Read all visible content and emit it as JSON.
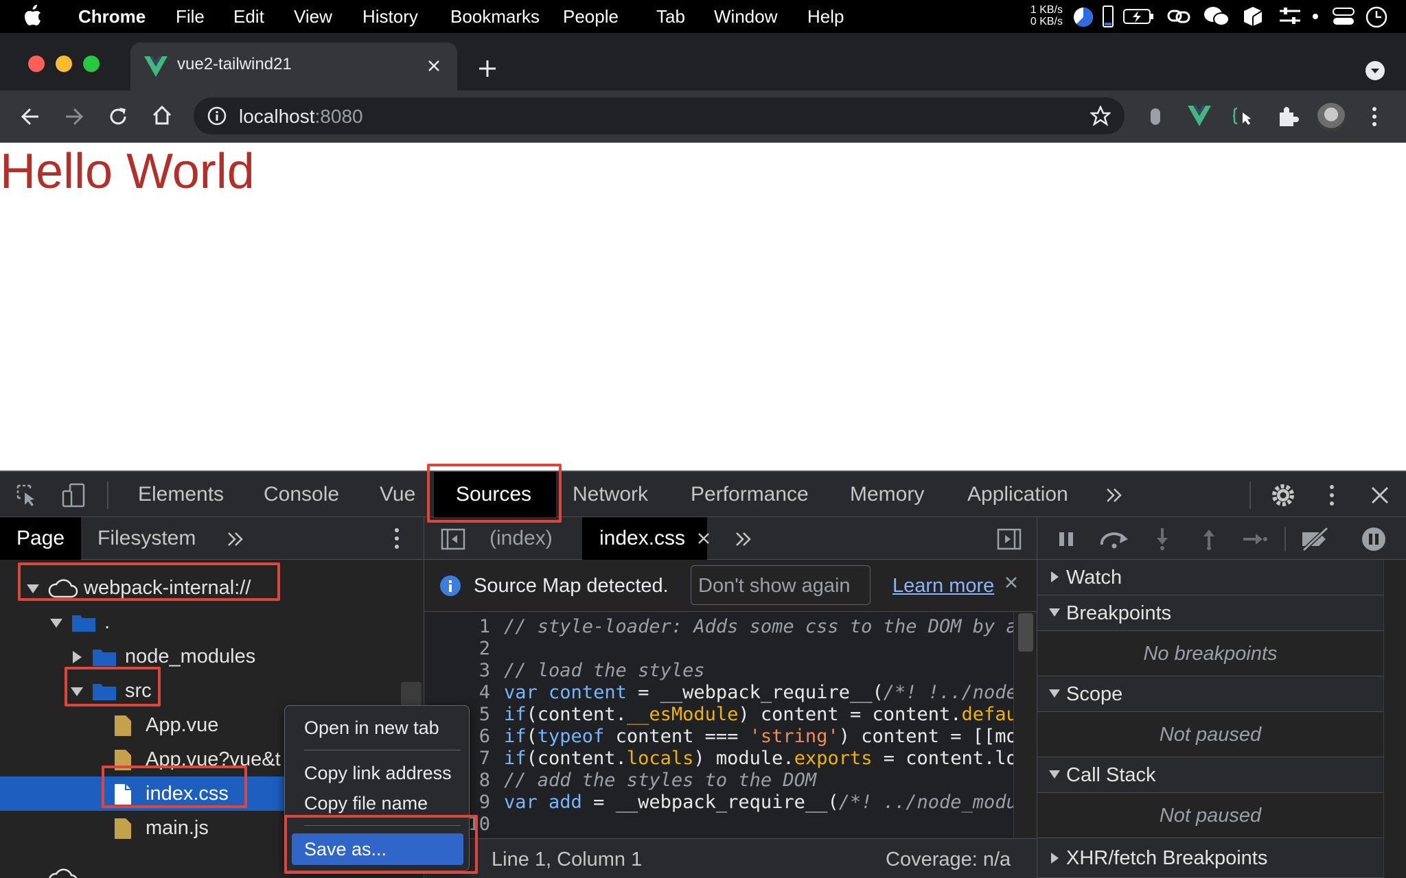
{
  "menubar": {
    "app": "Chrome",
    "items": [
      "File",
      "Edit",
      "View",
      "History",
      "Bookmarks",
      "People",
      "Tab",
      "Window",
      "Help"
    ],
    "net_up": "1 KB/s",
    "net_down": "0 KB/s"
  },
  "browser": {
    "tab_title": "vue2-tailwind21",
    "url_host": "localhost",
    "url_port": ":8080"
  },
  "page": {
    "heading": "Hello World"
  },
  "devtools": {
    "tabs": [
      "Elements",
      "Console",
      "Vue",
      "Sources",
      "Network",
      "Performance",
      "Memory",
      "Application"
    ],
    "active_tab": "Sources",
    "navigator": {
      "tabs": [
        "Page",
        "Filesystem"
      ],
      "tree": {
        "root": "webpack-internal://",
        "dot": ".",
        "node_modules": "node_modules",
        "src": "src",
        "files": [
          "App.vue",
          "App.vue?vue&t",
          "index.css",
          "main.js"
        ]
      }
    },
    "editor": {
      "tabs": [
        "(index)",
        "index.css"
      ],
      "infobar": {
        "message": "Source Map detected.",
        "dismiss": "Don't show again",
        "learn_more": "Learn more"
      },
      "line_numbers": [
        "1",
        "2",
        "3",
        "4",
        "5",
        "6",
        "7",
        "8",
        "9"
      ],
      "status": {
        "position": "Line 1, Column 1",
        "coverage": "Coverage: n/a"
      }
    },
    "debugger": {
      "sections": [
        "Watch",
        "Breakpoints",
        "Scope",
        "Call Stack",
        "XHR/fetch Breakpoints"
      ],
      "no_breakpoints": "No breakpoints",
      "scope_state": "Not paused",
      "callstack_state": "Not paused"
    },
    "context_menu": {
      "items": [
        "Open in new tab",
        "Copy link address",
        "Copy file name",
        "Save as..."
      ]
    }
  }
}
